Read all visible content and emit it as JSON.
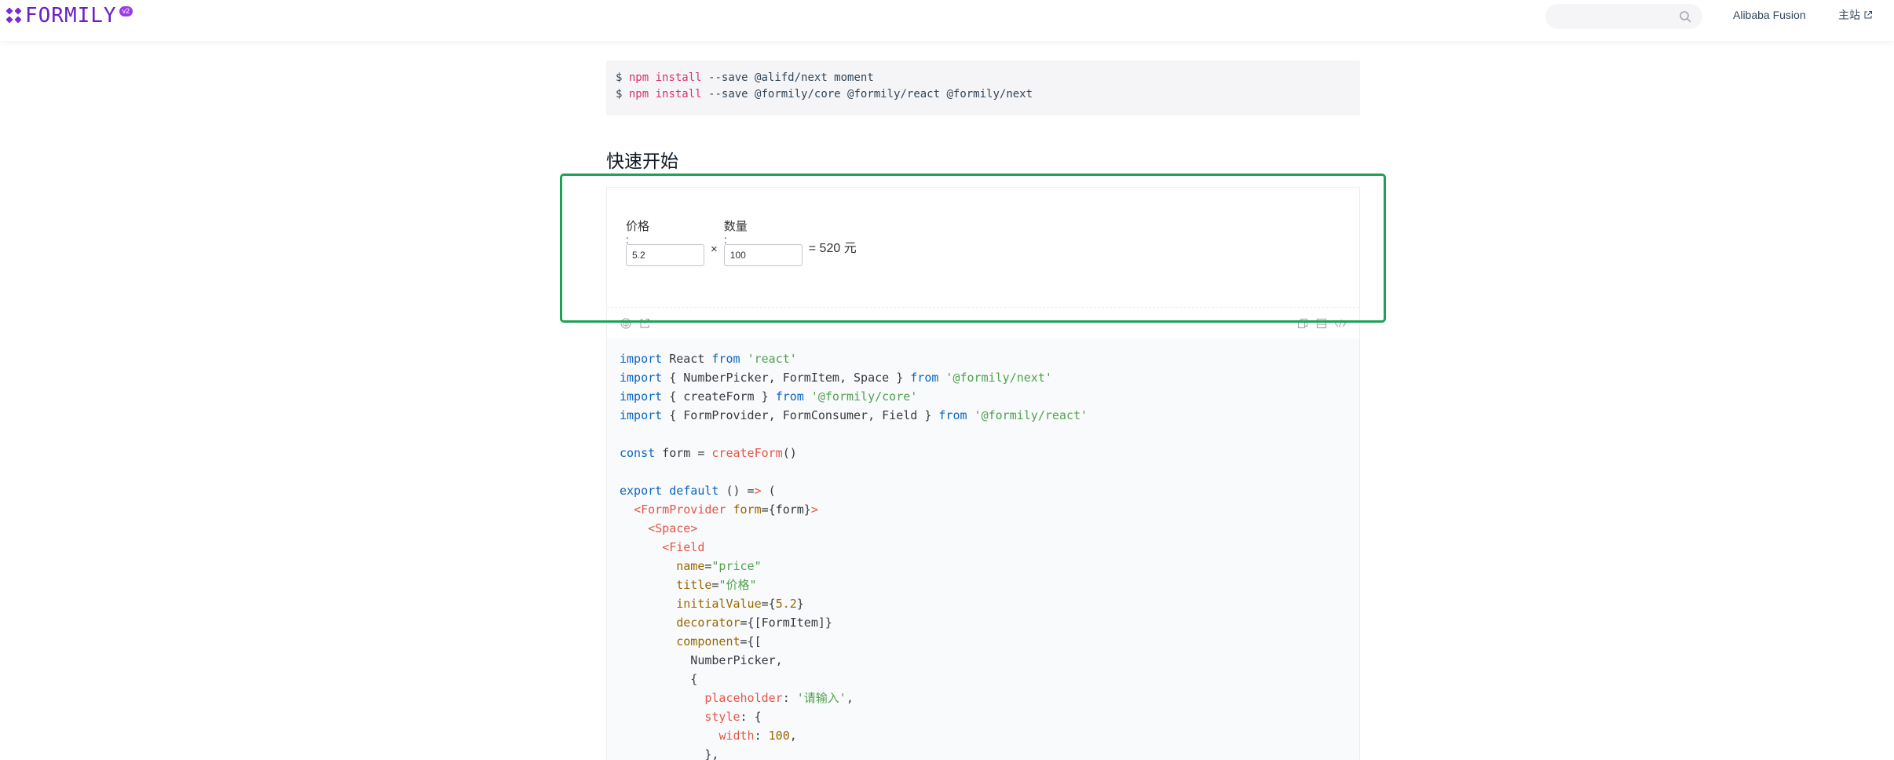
{
  "header": {
    "logo_text": "FORMILY",
    "logo_badge": "v2",
    "search": {
      "placeholder": "",
      "value": ""
    },
    "nav": {
      "fusion": "Alibaba Fusion",
      "home": "主站"
    }
  },
  "install": {
    "lines": [
      {
        "prompt": "$",
        "cmd": "npm install",
        "args": "--save @alifd/next moment"
      },
      {
        "prompt": "$",
        "cmd": "npm install",
        "args": "--save @formily/core @formily/react @formily/next"
      }
    ]
  },
  "section_title": "快速开始",
  "demo": {
    "price": {
      "label": "价格",
      "colon": ":",
      "value": "5.2"
    },
    "times": "×",
    "count": {
      "label": "数量",
      "colon": ":",
      "value": "100"
    },
    "result": "= 520 元"
  },
  "code_lines": [
    "import React from 'react'",
    "import { NumberPicker, FormItem, Space } from '@formily/next'",
    "import { createForm } from '@formily/core'",
    "import { FormProvider, FormConsumer, Field } from '@formily/react'",
    "",
    "const form = createForm()",
    "",
    "export default () => (",
    "  <FormProvider form={form}>",
    "    <Space>",
    "      <Field",
    "        name=\"price\"",
    "        title=\"价格\"",
    "        initialValue={5.2}",
    "        decorator={[FormItem]}",
    "        component={[",
    "          NumberPicker,",
    "          {",
    "            placeholder: '请输入',",
    "            style: {",
    "              width: 100,",
    "            },"
  ],
  "colors": {
    "brand": "#6a1fc4",
    "highlight": "#1fa055",
    "keyword": "#0b66c3",
    "string": "#50a14f",
    "tag": "#e45649",
    "attr": "#986801",
    "npm": "#d6336c"
  }
}
